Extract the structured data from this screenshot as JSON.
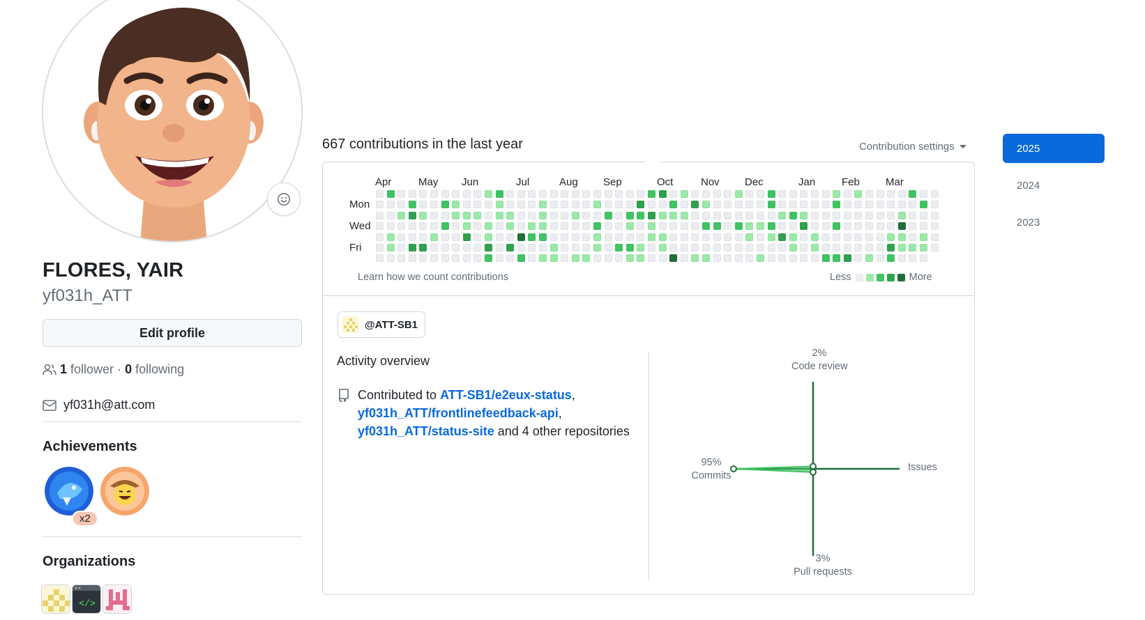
{
  "profile": {
    "full_name": "FLORES, YAIR",
    "login": "yf031h_ATT",
    "edit_profile_label": "Edit profile",
    "followers_count": "1",
    "followers_label": "follower",
    "separator": "·",
    "following_count": "0",
    "following_label": "following",
    "email": "yf031h@att.com",
    "emoji_icon": "smiley-icon"
  },
  "achievements": {
    "title": "Achievements",
    "items": [
      {
        "name": "pull-shark",
        "count_label": "x2"
      },
      {
        "name": "yolo",
        "count_label": ""
      }
    ]
  },
  "organizations": {
    "title": "Organizations",
    "items": [
      "ATT-SB1",
      "code-org",
      "pink-org"
    ]
  },
  "contributions": {
    "title": "667 contributions in the last year",
    "settings_label": "Contribution settings",
    "months": [
      "Apr",
      "May",
      "Jun",
      "Jul",
      "Aug",
      "Sep",
      "Oct",
      "Nov",
      "Dec",
      "Jan",
      "Feb",
      "Mar"
    ],
    "day_labels": [
      "Mon",
      "Wed",
      "Fri"
    ],
    "learn_link": "Learn how we count contributions",
    "legend_less": "Less",
    "legend_more": "More",
    "level_colors": [
      "#ebedf0",
      "#9be9a8",
      "#40c463",
      "#30a14e",
      "#216e39"
    ],
    "weeks": 52,
    "levels": [
      [
        0,
        0,
        1,
        2,
        0,
        0,
        0,
        0,
        1
      ],
      [
        0,
        1,
        1,
        1,
        0,
        0,
        0,
        0,
        2
      ],
      [
        0,
        0,
        0,
        2,
        1,
        1,
        1,
        0,
        0
      ],
      [
        0,
        0,
        1,
        1,
        0,
        0,
        1,
        0,
        0
      ],
      [
        0,
        0,
        0,
        0,
        1,
        0,
        1,
        0,
        0
      ]
    ]
  },
  "org_chip": {
    "label": "@ATT-SB1"
  },
  "activity": {
    "title": "Activity overview",
    "contributed_to": "Contributed to",
    "repo1": "ATT-SB1/e2eux-status",
    "comma": ",",
    "repo2": "yf031h_ATT/frontlinefeedback-api",
    "repo3": "yf031h_ATT/status-site",
    "tail": "and 4 other repositories",
    "radar": {
      "code_review_pct": "2%",
      "code_review_label": "Code review",
      "issues_label": "Issues",
      "pull_requests_pct": "3%",
      "pull_requests_label": "Pull requests",
      "commits_pct": "95%",
      "commits_label": "Commits",
      "values": {
        "commits": 95,
        "code_review": 2,
        "pull_requests": 3,
        "issues": 0
      }
    }
  },
  "years": [
    "2025",
    "2024",
    "2023"
  ],
  "colors": {
    "accent": "#0969da",
    "radar_line": "#216e39",
    "radar_fill": "#40c463"
  }
}
